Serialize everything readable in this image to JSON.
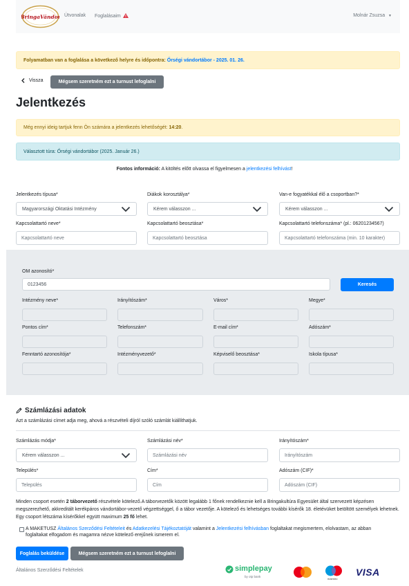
{
  "nav": {
    "logo_text": "BringaVándor",
    "routes": "Útvonalak",
    "bookings": "Foglalásaim",
    "user": "Molnár Zsuzsa"
  },
  "alert_top": {
    "text": "Folyamatban van a foglalása a következő helyre és időpontra:",
    "link": "Őrségi vándortábor - 2025. 01. 26."
  },
  "back_label": "Vissza",
  "cancel_top_label": "Mégsem szeretném ezt a turnust lefoglalni",
  "page_title": "Jelentkezés",
  "timer": {
    "text": "Még ennyi ideig tartjuk fenn Ön számára a jelentkezés lehetőségét:",
    "time": "14:20",
    "suffix": "."
  },
  "selected_tour": "Választott túra: Őrségi vándortábor (2025. Január 26.)",
  "info": {
    "bold": "Fontos információ:",
    "text": "A kitöltés előtt olvassa el figyelmesen a",
    "link": "jelentkezési felhívást",
    "suffix": "!"
  },
  "form": {
    "type_label": "Jelentkezés típusa*",
    "type_value": "Magyarországi Oktatási Intézmény",
    "age_label": "Diákok korosztálya*",
    "age_value": "Kérem válasszon ...",
    "disabled_label": "Van-e fogyatékkal élő a csoportban?*",
    "disabled_value": "Kérem válasszon ...",
    "contact_name_label": "Kapcsolattartó neve*",
    "contact_name_ph": "Kapcsolattartó neve",
    "contact_pos_label": "Kapcsolattartó beosztása*",
    "contact_pos_ph": "Kapcsolattartó beosztása",
    "contact_phone_label": "Kapcsolattartó telefonszáma* (pl.: 06201234567)",
    "contact_phone_ph": "Kapcsolattartó telefonszáma (min. 10 karakter)"
  },
  "school": {
    "om_label": "OM azonosító*",
    "om_value": "0123456",
    "search_label": "Keresés",
    "fields": [
      "Intézmény neve*",
      "Irányítószám*",
      "Város*",
      "Megye*",
      "Pontos cím*",
      "Telefonszám*",
      "E-mail cím*",
      "Adószám*",
      "Fenntartó azonosítója*",
      "Intézményvezető*",
      "Képviselő beosztása*",
      "Iskola típusa*"
    ]
  },
  "billing": {
    "title": "Számlázási adatok",
    "desc": "Azt a számlázási címet adja meg, ahová a részvételi díjról szóló számlát kiállíthatjuk.",
    "mode_label": "Számlázás módja*",
    "mode_value": "Kérem válasszon ...",
    "name_label": "Számlázási név*",
    "name_ph": "Számlázási név",
    "zip_label": "Irányítószám*",
    "zip_ph": "Irányítószám",
    "city_label": "Település*",
    "city_ph": "Település",
    "addr_label": "Cím*",
    "addr_ph": "Cím",
    "tax_label": "Adószám (CIF)*",
    "tax_ph": "Adószám (CIF)"
  },
  "notice": {
    "p1": "Minden csoport esetén",
    "b1": "2 táborvezető",
    "p2": "részvétele kötelező.A táborvezetők között legalább 1 főnek rendelkeznie kell a Bringakultúra Egyesület által szervezett képzésen megszerezhető, akkreditált kerékpáros vándortábor-vezető végzettséggel, ő a tábor vezetője. A kötelező és lehetséges további kísérők 18. életévüket betöltött személyek lehetnek. Egy csoport létszáma kísérőkkel együtt maximum",
    "b2": "25 fő",
    "p3": "lehet."
  },
  "terms": {
    "t1": "A MAKETUSZ",
    "l1": "Általános Szerződési Feltételeit",
    "t2": "és",
    "l2": "Adatkezelési Tájékoztatóját",
    "t3": "valamint a",
    "l3": "Jelentkezési felhívásban",
    "t4": "foglaltakat megismertem, elolvastam, az abban foglaltakat elfogadom és magamra nézve kötelező erejűnek ismerem el."
  },
  "submit_label": "Foglalás beküldése",
  "cancel_bottom_label": "Mégsem szeretném ezt a turnust lefoglalni",
  "footer_link": "Általános Szerződési Feltételek",
  "payment": {
    "simplepay": "simplepay",
    "simplepay_sub": "by otp bank",
    "maestro": "maestro",
    "visa": "VISA"
  },
  "colors": {
    "primary": "#007bff",
    "secondary": "#6c757d",
    "warning_bg": "#fff3cd",
    "info_bg": "#d1ecf1",
    "danger": "#dc3545"
  }
}
